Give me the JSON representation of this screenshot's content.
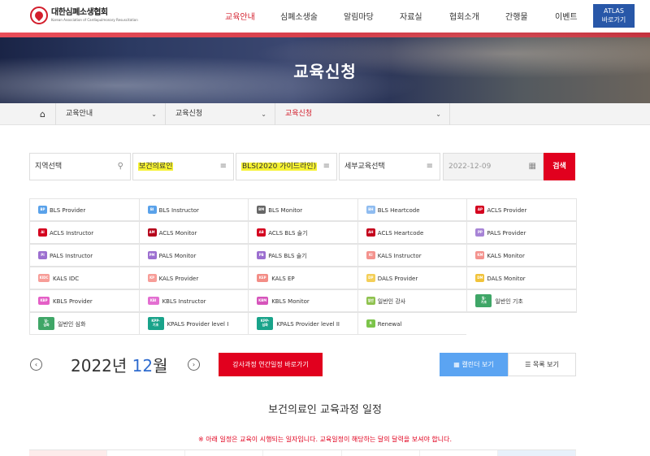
{
  "header": {
    "logo_ko": "대한심폐소생협회",
    "logo_en": "Korean Association of Cardiopulmonary Resuscitation",
    "nav": [
      "교육안내",
      "심폐소생술",
      "알림마당",
      "자료실",
      "협회소개",
      "간행물",
      "이벤트"
    ],
    "active_nav": "교육안내",
    "atlas_line1": "ATLAS",
    "atlas_line2": "바로가기"
  },
  "banner": {
    "title": "교육신청"
  },
  "breadcrumb": {
    "items": [
      "교육안내",
      "교육신청",
      "교육신청"
    ]
  },
  "search": {
    "region": "지역선택",
    "category": "보건의료인",
    "course": "BLS(2020 가이드라인)",
    "sub_course": "세부교육선택",
    "date": "2022-12-09",
    "button": "검색"
  },
  "courses": [
    {
      "badge": "BP",
      "label": "BLS Provider",
      "color": "#5aa2ea"
    },
    {
      "badge": "BI",
      "label": "BLS Instructor",
      "color": "#5aa2ea"
    },
    {
      "badge": "BM",
      "label": "BLS Monitor",
      "color": "#666666"
    },
    {
      "badge": "BH",
      "label": "BLS Heartcode",
      "color": "#8fbcf0"
    },
    {
      "badge": "AP",
      "label": "ACLS Provider",
      "color": "#d4001f"
    },
    {
      "badge": "AI",
      "label": "ACLS Instructor",
      "color": "#d4001f"
    },
    {
      "badge": "AM",
      "label": "ACLS Monitor",
      "color": "#b5001a"
    },
    {
      "badge": "AB",
      "label": "ACLS BLS 술기",
      "color": "#d4001f"
    },
    {
      "badge": "AH",
      "label": "ACLS Heartcode",
      "color": "#c4001c"
    },
    {
      "badge": "PP",
      "label": "PALS Provider",
      "color": "#a784d6"
    },
    {
      "badge": "PI",
      "label": "PALS Instructor",
      "color": "#9c6fd0"
    },
    {
      "badge": "PM",
      "label": "PALS Monitor",
      "color": "#9c6fd0"
    },
    {
      "badge": "PB",
      "label": "PALS BLS 술기",
      "color": "#9c6fd0"
    },
    {
      "badge": "KI",
      "label": "KALS Instructor",
      "color": "#f4938e"
    },
    {
      "badge": "KM",
      "label": "KALS Monitor",
      "color": "#f4938e"
    },
    {
      "badge": "KIDC",
      "label": "KALS IDC",
      "color": "#f79d98"
    },
    {
      "badge": "KP",
      "label": "KALS Provider",
      "color": "#f79d98"
    },
    {
      "badge": "KEP",
      "label": "KALS EP",
      "color": "#f38d86"
    },
    {
      "badge": "DP",
      "label": "DALS Provider",
      "color": "#f4cf58"
    },
    {
      "badge": "DM",
      "label": "DALS Monitor",
      "color": "#f1c33a"
    },
    {
      "badge": "KBP",
      "label": "KBLS Provider",
      "color": "#e45fc6"
    },
    {
      "badge": "KBI",
      "label": "KBLS Instructor",
      "color": "#e36fd1"
    },
    {
      "badge": "KBM",
      "label": "KBLS Monitor",
      "color": "#d654bb"
    },
    {
      "badge": "일반",
      "label": "일반인 강사",
      "color": "#8fc24f"
    },
    {
      "badge": "일-기초",
      "label": "일반인 기초",
      "color": "#3fa667"
    },
    {
      "badge": "일-심화",
      "label": "일반인 심화",
      "color": "#3fa667"
    },
    {
      "badge": "KPP-기초",
      "label": "KPALS Provider level I",
      "color": "#19a38a"
    },
    {
      "badge": "KPP-심화",
      "label": "KPALS Provider level II",
      "color": "#19a38a"
    },
    {
      "badge": "R",
      "label": "Renewal",
      "color": "#7cc44a"
    }
  ],
  "calendar": {
    "year_text": "2022년",
    "month_num": "12",
    "month_suffix": "월",
    "annual_btn": "강사과정 연간일정 바로가기",
    "calendar_btn": "캘린더 보기",
    "list_btn": "목록 보기",
    "schedule_title": "보건의료인 교육과정 일정",
    "notice": "※ 아래 일정은 교육이 시행되는 일자입니다. 교육일정이 해당하는 달의 달력을 보셔야 합니다."
  }
}
